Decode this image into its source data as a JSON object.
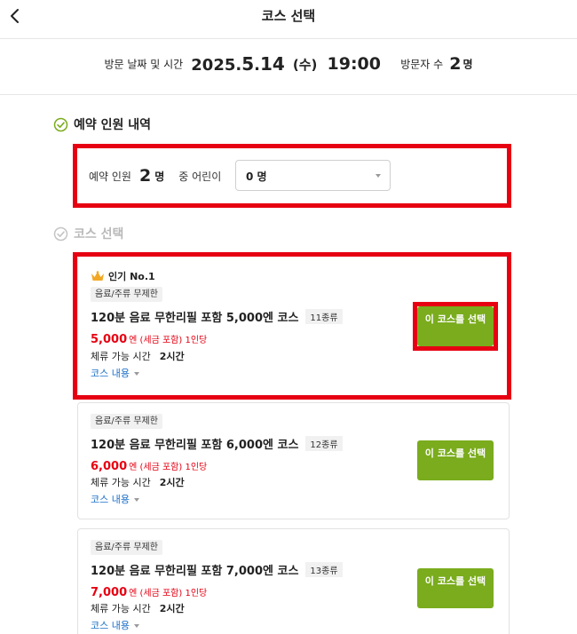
{
  "header": {
    "title": "코스 선택",
    "back_icon": "chevron-left-icon"
  },
  "visit": {
    "date_label": "방문 날짜 및 시간",
    "year": "2025.",
    "month": "5",
    "day": "14",
    "weekday": "(수)",
    "time": "19:00",
    "guests_label": "방문자 수",
    "guests_count": "2",
    "guests_unit": "명"
  },
  "reservation": {
    "section_title": "예약 인원 내역",
    "people_label": "예약 인원",
    "people_count": "2",
    "people_unit": "명",
    "children_label": "중 어린이",
    "children_value": "0 명"
  },
  "course_section": {
    "title": "코스 선택"
  },
  "courses": [
    {
      "popular": "인기 No.1",
      "tag": "음료/주류 무제한",
      "name": "120분 음료 무한리필 포함 5,000엔 코스",
      "types": "11종류",
      "price": "5,000",
      "price_suffix": "엔 (세금 포함) 1인당",
      "stay_label": "체류 가능 시간",
      "stay_value": "2시간",
      "details_link": "코스 내용",
      "button_label": "이 코스를 선택"
    },
    {
      "tag": "음료/주류 무제한",
      "name": "120분 음료 무한리필 포함 6,000엔 코스",
      "types": "12종류",
      "price": "6,000",
      "price_suffix": "엔 (세금 포함) 1인당",
      "stay_label": "체류 가능 시간",
      "stay_value": "2시간",
      "details_link": "코스 내용",
      "button_label": "이 코스를 선택"
    },
    {
      "tag": "음료/주류 무제한",
      "name": "120분 음료 무한리필 포함 7,000엔 코스",
      "types": "13종류",
      "price": "7,000",
      "price_suffix": "엔 (세금 포함) 1인당",
      "stay_label": "체류 가능 시간",
      "stay_value": "2시간",
      "details_link": "코스 내용",
      "button_label": "이 코스를 선택"
    }
  ],
  "colors": {
    "accent_green": "#7aac1d",
    "price_red": "#e60012",
    "highlight_red": "#e60012",
    "link_blue": "#1a6fc9"
  }
}
